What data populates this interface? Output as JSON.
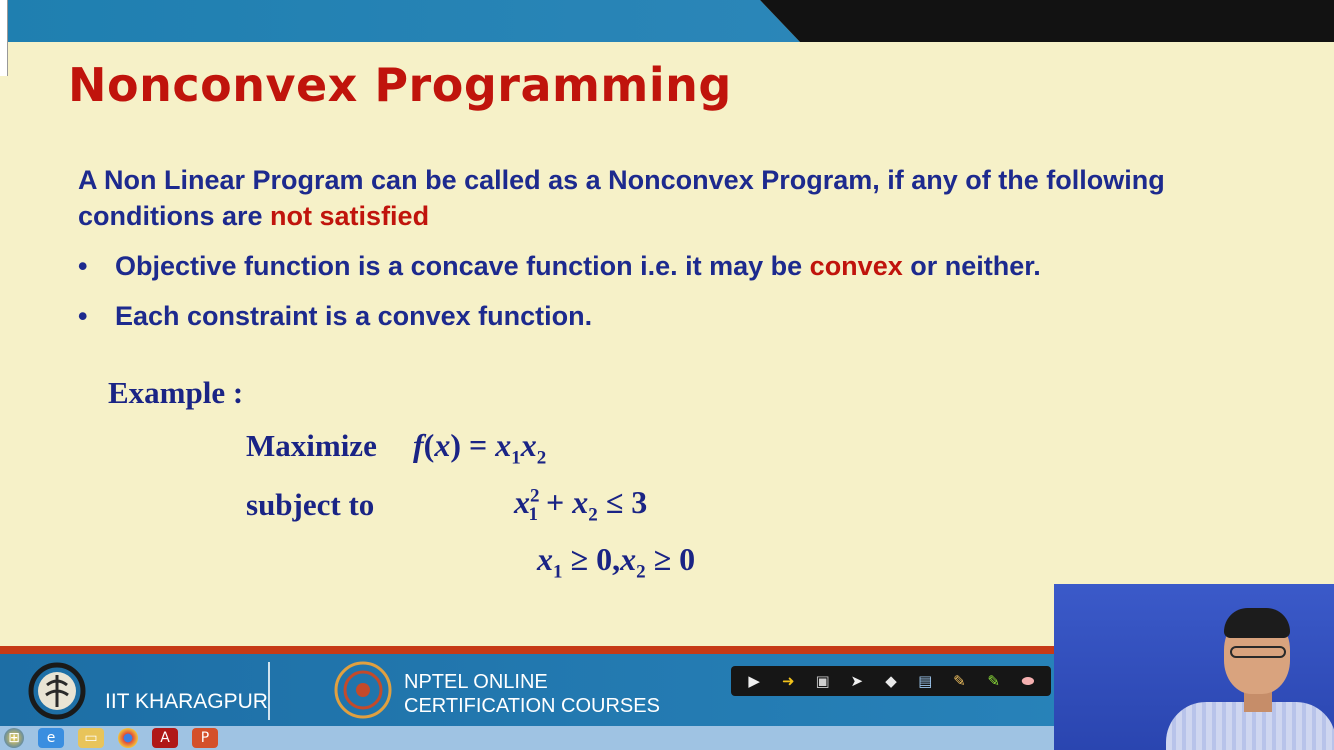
{
  "slide": {
    "title": "Nonconvex Programming",
    "intro_main": "A Non Linear Program can be called as a Nonconvex Program, if any of the following conditions are ",
    "intro_highlight": "not satisfied",
    "bullets": [
      {
        "dot": "•",
        "pre": "Objective function is a concave function i.e. it may be ",
        "highlight": "convex",
        "post": " or neither."
      },
      {
        "dot": "•",
        "pre": "Each constraint is a convex function.",
        "highlight": "",
        "post": ""
      }
    ],
    "example": {
      "label": "Example :",
      "maximize_label": "Maximize",
      "objective": {
        "f": "f",
        "lp": "(",
        "x": "x",
        "rp": ")",
        "eq": " = ",
        "x1": "x",
        "s1": "1",
        "x2": "x",
        "s2": "2"
      },
      "subject_label": "subject to",
      "constraint1": {
        "x": "x",
        "sup": "2",
        "sub": "1",
        "plus": " + ",
        "x2": "x",
        "sub2": "2",
        "rel": " ≤ 3"
      },
      "constraint2": {
        "x": "x",
        "sub": "1",
        "rel1": " ≥ 0,",
        "x2": "x",
        "sub2": "2",
        "rel2": " ≥ 0"
      }
    }
  },
  "footer": {
    "institute": "IIT KHARAGPUR",
    "nptel_line1": "NPTEL ONLINE",
    "nptel_line2": "CERTIFICATION COURSES"
  },
  "toolbar_icons": [
    "play-icon",
    "arrow-icon",
    "camera-icon",
    "pointer-icon",
    "eraser-icon",
    "screen-icon",
    "pen-icon",
    "highlighter-icon",
    "ink-eraser-icon"
  ],
  "taskbar_icons": [
    "start-icon",
    "internet-explorer-icon",
    "folder-icon",
    "chrome-icon",
    "acrobat-icon",
    "powerpoint-icon"
  ],
  "colors": {
    "title_red": "#c0140c",
    "text_blue": "#1d2a8e",
    "slide_bg": "#f6f1c8",
    "footer_blue": "#2a87be"
  }
}
